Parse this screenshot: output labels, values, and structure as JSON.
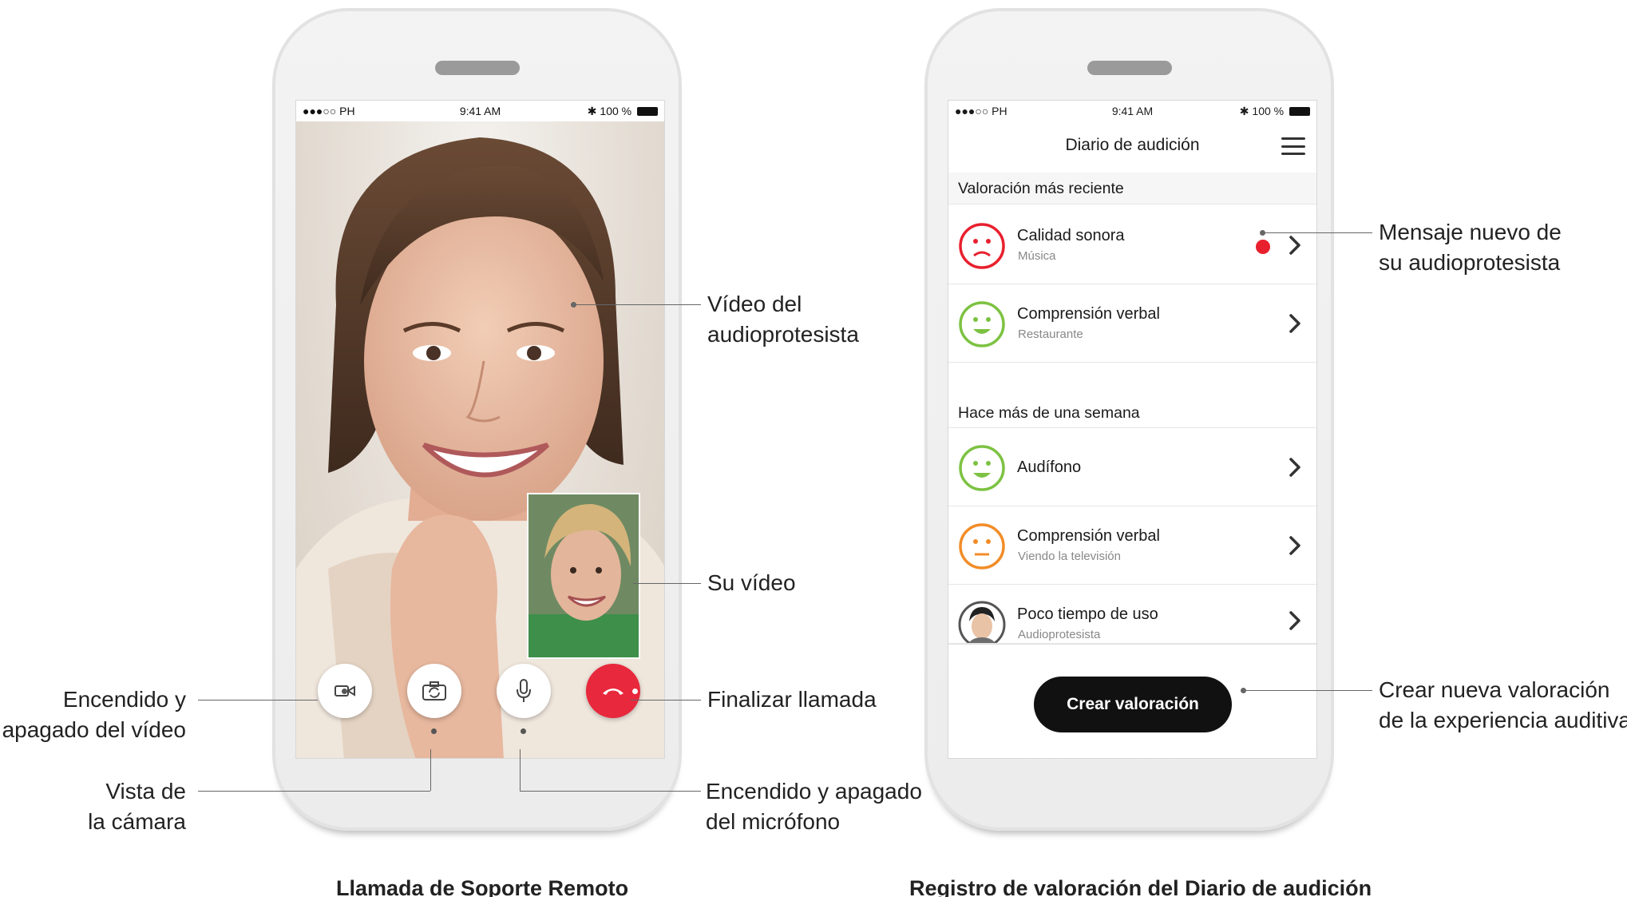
{
  "status_bar": {
    "carrier": "●●●○○ PH",
    "time": "9:41 AM",
    "battery": "100 %"
  },
  "call_screen": {
    "annotations": {
      "specialist_video": [
        "Vídeo del",
        "audioprotesista"
      ],
      "your_video": "Su vídeo",
      "end_call": "Finalizar llamada",
      "video_toggle": [
        "Encendido y",
        "apagado del vídeo"
      ],
      "camera_view": [
        "Vista de",
        "la cámara"
      ],
      "mic_toggle": [
        "Encendido y apagado",
        "del micrófono"
      ]
    },
    "caption": "Llamada de Soporte Remoto"
  },
  "diary_screen": {
    "title": "Diario de audición",
    "section_recent": "Valoración más reciente",
    "section_older": "Hace más de una semana",
    "items": [
      {
        "title": "Calidad sonora",
        "subtitle": "Música",
        "mood": "sad",
        "color": "#e8202e",
        "new_message": true
      },
      {
        "title": "Comprensión verbal",
        "subtitle": "Restaurante",
        "mood": "happy",
        "color": "#7cc242",
        "new_message": false
      },
      {
        "title": "Audífono",
        "subtitle": "",
        "mood": "happy",
        "color": "#7cc242",
        "new_message": false
      },
      {
        "title": "Comprensión verbal",
        "subtitle": "Viendo la televisión",
        "mood": "neutral",
        "color": "#f28c28",
        "new_message": false
      },
      {
        "title": "Poco tiempo de uso",
        "subtitle": "Audioprotesista",
        "mood": "avatar",
        "color": "#555555",
        "new_message": false
      }
    ],
    "cta_label": "Crear valoración",
    "annotations": {
      "new_message": [
        "Mensaje nuevo de",
        "su audioprotesista"
      ],
      "create_new": [
        "Crear nueva valoración",
        "de la experiencia auditiva"
      ]
    },
    "caption": "Registro de valoración del Diario de audición"
  },
  "colors": {
    "end_call": "#e8283c",
    "cta": "#111111",
    "notification": "#e8202e"
  }
}
